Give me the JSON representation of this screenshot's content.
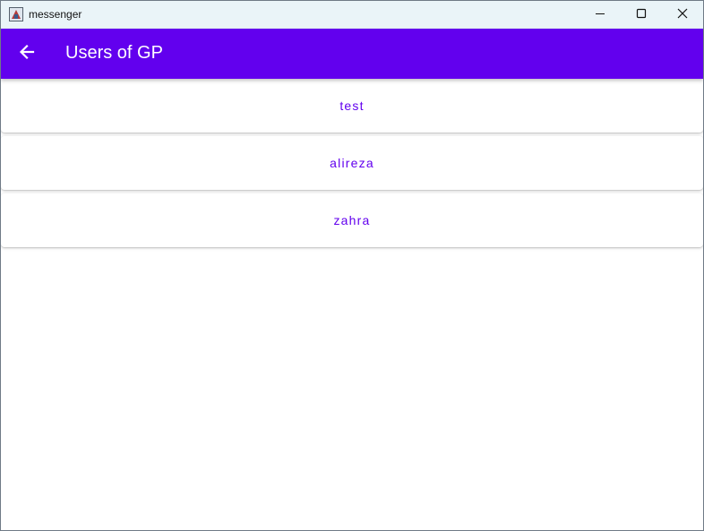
{
  "window": {
    "title": "messenger",
    "app_icon": "java-app-icon",
    "controls": {
      "minimize_icon": "minimize-icon",
      "maximize_icon": "maximize-icon",
      "close_icon": "close-icon"
    }
  },
  "appbar": {
    "back_icon": "arrow-back-icon",
    "title": "Users of GP",
    "color": "#6200ee"
  },
  "users": [
    {
      "name": "test"
    },
    {
      "name": "alireza"
    },
    {
      "name": "zahra"
    }
  ],
  "colors": {
    "accent": "#6200ee",
    "titlebar_bg": "#eaf4f8",
    "background": "#ffffff"
  }
}
